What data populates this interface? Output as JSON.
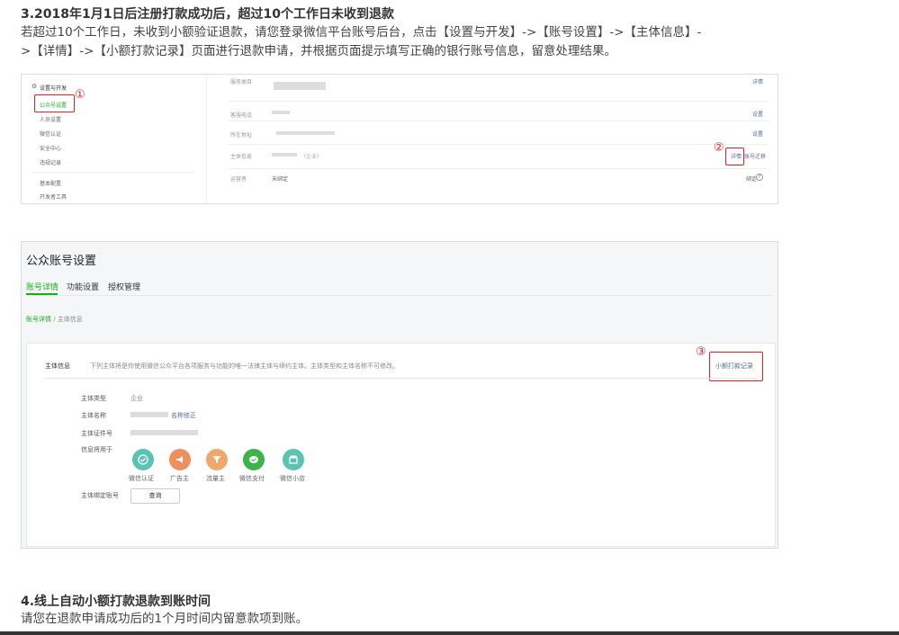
{
  "section3": {
    "title": "3.2018年1月1日后注册打款成功后，超过10个工作日未收到退款",
    "line1": "若超过10个工作日，未收到小额验证退款，请您登录微信平台账号后台，点击【设置与开发】->【账号设置】->【主体信息】-",
    "line2": ">【详情】->【小额打款记录】页面进行退款申请，并根据页面提示填写正确的银行账号信息，留意处理结果。"
  },
  "shot1": {
    "sidebar_group": "设置与开发",
    "sidebar_items": [
      "公众号设置",
      "人员设置",
      "微信认证",
      "安全中心",
      "违规记录"
    ],
    "sidebar_items2": [
      "基本配置",
      "开发者工具"
    ],
    "rows": [
      {
        "label": "服务类目",
        "action": "详情"
      },
      {
        "label": "客服电话",
        "action": "设置"
      },
      {
        "label": "所在地址",
        "action": "设置"
      },
      {
        "label": "主体信息",
        "extra": "（企业）",
        "action": "详情",
        "action2": "账号迁移"
      },
      {
        "label": "运营者",
        "value": "未绑定",
        "action": "绑定"
      }
    ],
    "marker1": "①",
    "marker2": "②"
  },
  "shot2": {
    "page_title": "公众账号设置",
    "tabs": [
      "账号详情",
      "功能设置",
      "授权管理"
    ],
    "breadcrumb_link": "账号详情",
    "breadcrumb_sep": " / ",
    "breadcrumb_current": "主体信息",
    "panel_label": "主体信息",
    "panel_desc": "下列主体将是你使用微信公众平台各项服务与功能的唯一法律主体与缔约主体。主体类型和主体名称不可修改。",
    "record_button": "小额打款记录",
    "marker3": "③",
    "type_label": "主体类型",
    "type_value": "企业",
    "name_label": "主体名称",
    "name_link": "名称修正",
    "cert_label": "主体证件号",
    "usage_label": "信息将用于",
    "usages": [
      "微信认证",
      "广告主",
      "流量主",
      "微信支付",
      "微信小店"
    ],
    "usage_colors": [
      "#5cc3b4",
      "#f08f5e",
      "#f0a86a",
      "#3fb24a",
      "#5cc3b4"
    ],
    "bind_label": "主体绑定账号",
    "query_button": "查询"
  },
  "section4": {
    "title": "4.线上自动小额打款退款到账时间",
    "line1": "请您在退款申请成功后的1个月时间内留意款项到账。"
  }
}
